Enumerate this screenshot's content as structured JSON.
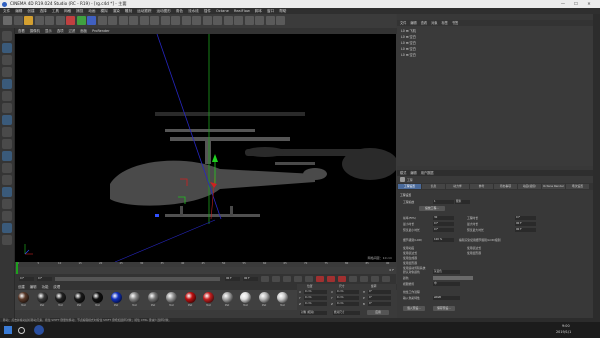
{
  "window": {
    "title": "CINEMA 4D R19.024 Studio (RC - R19) - [rg.c4d *] - 主要",
    "controls": [
      "—",
      "☐",
      "✕"
    ]
  },
  "menu": [
    "文件",
    "编辑",
    "创建",
    "选择",
    "工具",
    "网格",
    "捕捉",
    "动画",
    "模拟",
    "渲染",
    "雕刻",
    "运动跟踪",
    "运动图形",
    "角色",
    "流水线",
    "插件",
    "Octane",
    "RealFlow",
    "脚本",
    "窗口",
    "帮助"
  ],
  "viewport": {
    "menu": [
      "查看",
      "摄像机",
      "显示",
      "选项",
      "过滤",
      "面板",
      "ProRender"
    ],
    "grid_label": "网格间距：10 cm"
  },
  "timeline": {
    "ticks": [
      "0",
      "5",
      "10",
      "15",
      "20",
      "25",
      "30",
      "35",
      "40",
      "45",
      "50",
      "55",
      "60",
      "65",
      "70",
      "75",
      "80",
      "85",
      "90"
    ],
    "frame_left": "0 F",
    "frame_left2": "0 F",
    "frame_right": "90 F",
    "frame_right2": "90 F",
    "current": "0 F"
  },
  "materials": {
    "menu": [
      "创建",
      "编辑",
      "功能",
      "纹理"
    ],
    "items": [
      {
        "label": "Mat",
        "color": "#5a3a2a"
      },
      {
        "label": "Mat",
        "color": "#3a3a3a"
      },
      {
        "label": "Mat",
        "color": "#222222"
      },
      {
        "label": "Mat",
        "color": "#1a1a1a"
      },
      {
        "label": "Mat",
        "color": "#111111"
      },
      {
        "label": "Mat",
        "color": "#1030c0"
      },
      {
        "label": "Mat",
        "color": "#888888"
      },
      {
        "label": "Mat",
        "color": "#777777"
      },
      {
        "label": "Mat",
        "color": "#999999"
      },
      {
        "label": "Mat",
        "color": "#c01010"
      },
      {
        "label": "Mat",
        "color": "#c82020"
      },
      {
        "label": "Mat",
        "color": "#aaaaaa"
      },
      {
        "label": "Mat",
        "color": "#e0e0e0"
      },
      {
        "label": "Mat",
        "color": "#bbbbbb"
      },
      {
        "label": "Mat",
        "color": "#cccccc"
      }
    ]
  },
  "coords": {
    "headers": [
      "位置",
      "尺寸",
      "旋转"
    ],
    "rows": [
      {
        "a": "X",
        "av": "0 cm",
        "b": "X",
        "bv": "0 cm",
        "c": "H",
        "cv": "0°"
      },
      {
        "a": "Y",
        "av": "0 cm",
        "b": "Y",
        "bv": "0 cm",
        "c": "P",
        "cv": "0°"
      },
      {
        "a": "Z",
        "av": "0 cm",
        "b": "Z",
        "bv": "0 cm",
        "c": "B",
        "cv": "0°"
      }
    ],
    "mode": "对象 (相对)",
    "size_mode": "绝对尺寸",
    "apply": "应用"
  },
  "right_tabs": [
    "文件",
    "编辑",
    "查看",
    "对象",
    "标签",
    "书签"
  ],
  "objects": {
    "menu": [
      "文件",
      "编辑",
      "查看",
      "对象",
      "标签",
      "书签"
    ],
    "rows": [
      "L0 ⊞ 飞机",
      "L0 ⊞ 空白",
      "L0 ⊞ 空白",
      "L0 ⊞ 空白",
      "L0 ⊞ 空白"
    ]
  },
  "attributes": {
    "menu": [
      "模式",
      "编辑",
      "用户数据"
    ],
    "object_name": "工程",
    "tabs": [
      "工程设置",
      "信息",
      "动力学",
      "参考",
      "待办事项",
      "动画(插值)",
      "Octane Render",
      "场次设置"
    ],
    "section": "工程设置",
    "scale_label": "工程缩放",
    "scale_value": "1",
    "scale_unit": "厘米",
    "scale_button": "缩放工程...",
    "left_fields": [
      {
        "label": "帧率(FPS)",
        "value": "30"
      },
      {
        "label": "最小时长",
        "value": "0 F"
      },
      {
        "label": "预览最小时长",
        "value": "0 F"
      }
    ],
    "right_fields": [
      {
        "label": "工程时长",
        "value": "0 F"
      },
      {
        "label": "最大时长",
        "value": "90 F"
      },
      {
        "label": "预览最大时长",
        "value": "90 F"
      }
    ],
    "lod_label": "细节级别(LOD)",
    "lod_value": "100 %",
    "lod_check": "编辑渲染使用细节级别(LOD)级别",
    "checks": [
      "使用动画",
      "使用表达式",
      "使用生成器",
      "使用变形器",
      "使用运动剪辑系统"
    ],
    "checks_right": [
      "使用表达式",
      "使用变形器"
    ],
    "default_color_label": "默认对象颜色",
    "default_color_value": "灰蓝色",
    "color_label": "颜色",
    "view_clip_label": "视图修剪",
    "view_clip_value": "中",
    "linear_label": "线性工作流程",
    "input_color_label": "输入色彩特性",
    "input_color_value": "sRGB",
    "load_button": "载入预设...",
    "save_button": "保存预设..."
  },
  "status": "移动：点击并拖动鼠标移动元素。按住 SHIFT 键量化移动；节点编辑模式时按住 SHIFT 键增加选择对象；按住 CTRL 键减少选择对象。",
  "taskbar": {
    "time": "9:00",
    "date": "2019/1/1"
  }
}
